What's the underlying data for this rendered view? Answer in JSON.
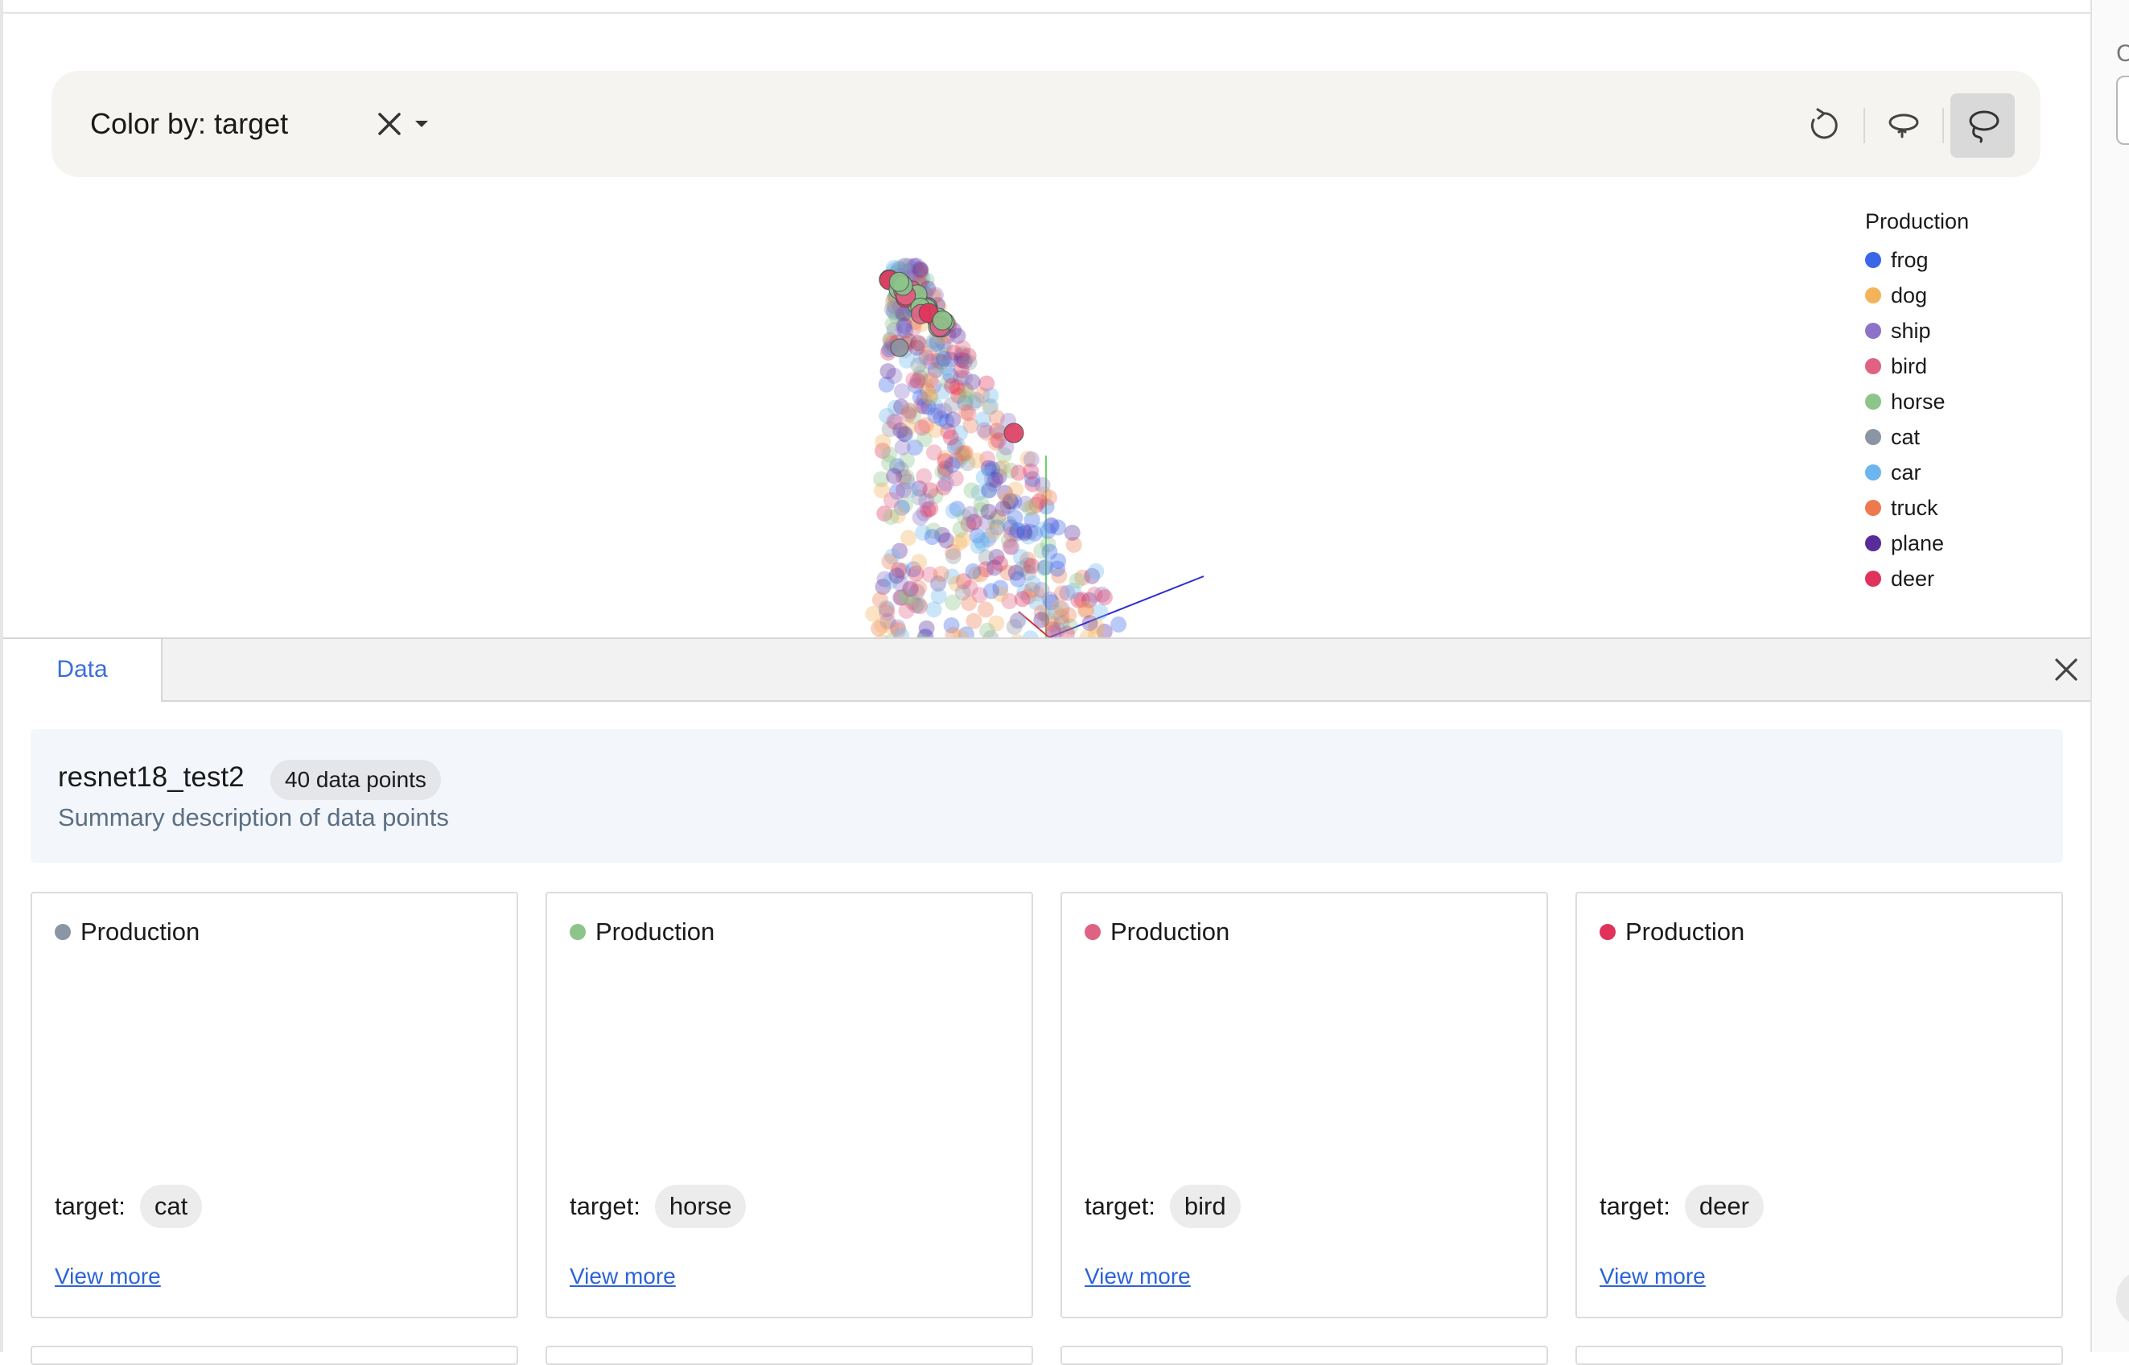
{
  "toolbar": {
    "color_by_label": "Color by: target"
  },
  "legend": {
    "title": "Production",
    "items": [
      {
        "label": "frog",
        "color": "#3a67e8"
      },
      {
        "label": "dog",
        "color": "#f4b35b"
      },
      {
        "label": "ship",
        "color": "#8d72c9"
      },
      {
        "label": "bird",
        "color": "#df6283"
      },
      {
        "label": "horse",
        "color": "#8cc48a"
      },
      {
        "label": "cat",
        "color": "#8a96a3"
      },
      {
        "label": "car",
        "color": "#6bb6ef"
      },
      {
        "label": "truck",
        "color": "#ed7a4f"
      },
      {
        "label": "plane",
        "color": "#5a2b9a"
      },
      {
        "label": "deer",
        "color": "#e0325a"
      }
    ]
  },
  "panel": {
    "tab_label": "Data",
    "summary_title": "resnet18_test2",
    "summary_count": "40 data points",
    "summary_desc": "Summary description of data points"
  },
  "cards": [
    {
      "source": "Production",
      "dot_color": "#8a96a3",
      "target_label": "target:",
      "target": "cat",
      "link": "View more"
    },
    {
      "source": "Production",
      "dot_color": "#8cc48a",
      "target_label": "target:",
      "target": "horse",
      "link": "View more"
    },
    {
      "source": "Production",
      "dot_color": "#df6283",
      "target_label": "target:",
      "target": "bird",
      "link": "View more"
    },
    {
      "source": "Production",
      "dot_color": "#e0325a",
      "target_label": "target:",
      "target": "deer",
      "link": "View more"
    }
  ]
}
